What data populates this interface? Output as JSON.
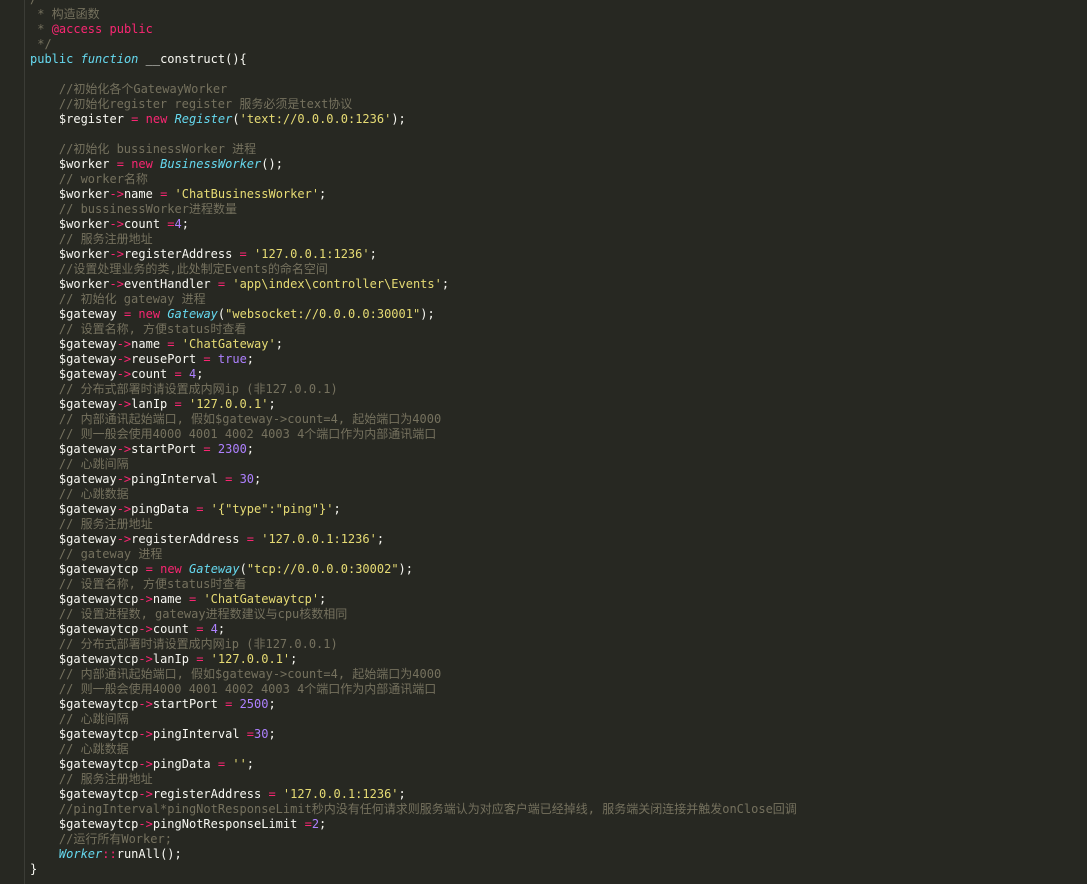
{
  "editor": {
    "lines": [
      [
        [
          "cm",
          "/**"
        ]
      ],
      [
        [
          "cm",
          " * 构造函数"
        ]
      ],
      [
        [
          "cm",
          " * "
        ],
        [
          "ann",
          "@access"
        ],
        [
          "cm",
          " "
        ],
        [
          "ann",
          "public"
        ]
      ],
      [
        [
          "cm",
          " */"
        ]
      ],
      [
        [
          "kw",
          "public"
        ],
        [
          "txt",
          " "
        ],
        [
          "kwi",
          "function"
        ],
        [
          "txt",
          " "
        ],
        [
          "fn",
          "__construct"
        ],
        [
          "pun",
          "(){"
        ]
      ],
      [],
      [
        [
          "txt",
          "    "
        ],
        [
          "cm",
          "//初始化各个GatewayWorker"
        ]
      ],
      [
        [
          "txt",
          "    "
        ],
        [
          "cm",
          "//初始化register register 服务必须是text协议"
        ]
      ],
      [
        [
          "txt",
          "    "
        ],
        [
          "var",
          "$register"
        ],
        [
          "txt",
          " "
        ],
        [
          "op",
          "="
        ],
        [
          "txt",
          " "
        ],
        [
          "op",
          "new"
        ],
        [
          "txt",
          " "
        ],
        [
          "cls",
          "Register"
        ],
        [
          "pun",
          "("
        ],
        [
          "str",
          "'text://0.0.0.0:1236'"
        ],
        [
          "pun",
          ");"
        ]
      ],
      [],
      [
        [
          "txt",
          "    "
        ],
        [
          "cm",
          "//初始化 bussinessWorker 进程"
        ]
      ],
      [
        [
          "txt",
          "    "
        ],
        [
          "var",
          "$worker"
        ],
        [
          "txt",
          " "
        ],
        [
          "op",
          "="
        ],
        [
          "txt",
          " "
        ],
        [
          "op",
          "new"
        ],
        [
          "txt",
          " "
        ],
        [
          "cls",
          "BusinessWorker"
        ],
        [
          "pun",
          "();"
        ]
      ],
      [
        [
          "txt",
          "    "
        ],
        [
          "cm",
          "// worker名称"
        ]
      ],
      [
        [
          "txt",
          "    "
        ],
        [
          "var",
          "$worker"
        ],
        [
          "op",
          "->"
        ],
        [
          "prop",
          "name"
        ],
        [
          "txt",
          " "
        ],
        [
          "op",
          "="
        ],
        [
          "txt",
          " "
        ],
        [
          "str",
          "'ChatBusinessWorker'"
        ],
        [
          "pun",
          ";"
        ]
      ],
      [
        [
          "txt",
          "    "
        ],
        [
          "cm",
          "// bussinessWorker进程数量"
        ]
      ],
      [
        [
          "txt",
          "    "
        ],
        [
          "var",
          "$worker"
        ],
        [
          "op",
          "->"
        ],
        [
          "prop",
          "count"
        ],
        [
          "txt",
          " "
        ],
        [
          "op",
          "="
        ],
        [
          "num",
          "4"
        ],
        [
          "pun",
          ";"
        ]
      ],
      [
        [
          "txt",
          "    "
        ],
        [
          "cm",
          "// 服务注册地址"
        ]
      ],
      [
        [
          "txt",
          "    "
        ],
        [
          "var",
          "$worker"
        ],
        [
          "op",
          "->"
        ],
        [
          "prop",
          "registerAddress"
        ],
        [
          "txt",
          " "
        ],
        [
          "op",
          "="
        ],
        [
          "txt",
          " "
        ],
        [
          "str",
          "'127.0.0.1:1236'"
        ],
        [
          "pun",
          ";"
        ]
      ],
      [
        [
          "txt",
          "    "
        ],
        [
          "cm",
          "//设置处理业务的类,此处制定Events的命名空间"
        ]
      ],
      [
        [
          "txt",
          "    "
        ],
        [
          "var",
          "$worker"
        ],
        [
          "op",
          "->"
        ],
        [
          "prop",
          "eventHandler"
        ],
        [
          "txt",
          " "
        ],
        [
          "op",
          "="
        ],
        [
          "txt",
          " "
        ],
        [
          "str",
          "'app\\index\\controller\\Events'"
        ],
        [
          "pun",
          ";"
        ]
      ],
      [
        [
          "txt",
          "    "
        ],
        [
          "cm",
          "// 初始化 gateway 进程"
        ]
      ],
      [
        [
          "txt",
          "    "
        ],
        [
          "var",
          "$gateway"
        ],
        [
          "txt",
          " "
        ],
        [
          "op",
          "="
        ],
        [
          "txt",
          " "
        ],
        [
          "op",
          "new"
        ],
        [
          "txt",
          " "
        ],
        [
          "cls",
          "Gateway"
        ],
        [
          "pun",
          "("
        ],
        [
          "str",
          "\"websocket://0.0.0.0:30001\""
        ],
        [
          "pun",
          ");"
        ]
      ],
      [
        [
          "txt",
          "    "
        ],
        [
          "cm",
          "// 设置名称, 方便status时查看"
        ]
      ],
      [
        [
          "txt",
          "    "
        ],
        [
          "var",
          "$gateway"
        ],
        [
          "op",
          "->"
        ],
        [
          "prop",
          "name"
        ],
        [
          "txt",
          " "
        ],
        [
          "op",
          "="
        ],
        [
          "txt",
          " "
        ],
        [
          "str",
          "'ChatGateway'"
        ],
        [
          "pun",
          ";"
        ]
      ],
      [
        [
          "txt",
          "    "
        ],
        [
          "var",
          "$gateway"
        ],
        [
          "op",
          "->"
        ],
        [
          "prop",
          "reusePort"
        ],
        [
          "txt",
          " "
        ],
        [
          "op",
          "="
        ],
        [
          "txt",
          " "
        ],
        [
          "bool",
          "true"
        ],
        [
          "pun",
          ";"
        ]
      ],
      [
        [
          "txt",
          "    "
        ],
        [
          "var",
          "$gateway"
        ],
        [
          "op",
          "->"
        ],
        [
          "prop",
          "count"
        ],
        [
          "txt",
          " "
        ],
        [
          "op",
          "="
        ],
        [
          "txt",
          " "
        ],
        [
          "num",
          "4"
        ],
        [
          "pun",
          ";"
        ]
      ],
      [
        [
          "txt",
          "    "
        ],
        [
          "cm",
          "// 分布式部署时请设置成内网ip (非127.0.0.1)"
        ]
      ],
      [
        [
          "txt",
          "    "
        ],
        [
          "var",
          "$gateway"
        ],
        [
          "op",
          "->"
        ],
        [
          "prop",
          "lanIp"
        ],
        [
          "txt",
          " "
        ],
        [
          "op",
          "="
        ],
        [
          "txt",
          " "
        ],
        [
          "str",
          "'127.0.0.1'"
        ],
        [
          "pun",
          ";"
        ]
      ],
      [
        [
          "txt",
          "    "
        ],
        [
          "cm",
          "// 内部通讯起始端口, 假如$gateway->count=4, 起始端口为4000"
        ]
      ],
      [
        [
          "txt",
          "    "
        ],
        [
          "cm",
          "// 则一般会使用4000 4001 4002 4003 4个端口作为内部通讯端口"
        ]
      ],
      [
        [
          "txt",
          "    "
        ],
        [
          "var",
          "$gateway"
        ],
        [
          "op",
          "->"
        ],
        [
          "prop",
          "startPort"
        ],
        [
          "txt",
          " "
        ],
        [
          "op",
          "="
        ],
        [
          "txt",
          " "
        ],
        [
          "num",
          "2300"
        ],
        [
          "pun",
          ";"
        ]
      ],
      [
        [
          "txt",
          "    "
        ],
        [
          "cm",
          "// 心跳间隔"
        ]
      ],
      [
        [
          "txt",
          "    "
        ],
        [
          "var",
          "$gateway"
        ],
        [
          "op",
          "->"
        ],
        [
          "prop",
          "pingInterval"
        ],
        [
          "txt",
          " "
        ],
        [
          "op",
          "="
        ],
        [
          "txt",
          " "
        ],
        [
          "num",
          "30"
        ],
        [
          "pun",
          ";"
        ]
      ],
      [
        [
          "txt",
          "    "
        ],
        [
          "cm",
          "// 心跳数据"
        ]
      ],
      [
        [
          "txt",
          "    "
        ],
        [
          "var",
          "$gateway"
        ],
        [
          "op",
          "->"
        ],
        [
          "prop",
          "pingData"
        ],
        [
          "txt",
          " "
        ],
        [
          "op",
          "="
        ],
        [
          "txt",
          " "
        ],
        [
          "str",
          "'{\"type\":\"ping\"}'"
        ],
        [
          "pun",
          ";"
        ]
      ],
      [
        [
          "txt",
          "    "
        ],
        [
          "cm",
          "// 服务注册地址"
        ]
      ],
      [
        [
          "txt",
          "    "
        ],
        [
          "var",
          "$gateway"
        ],
        [
          "op",
          "->"
        ],
        [
          "prop",
          "registerAddress"
        ],
        [
          "txt",
          " "
        ],
        [
          "op",
          "="
        ],
        [
          "txt",
          " "
        ],
        [
          "str",
          "'127.0.0.1:1236'"
        ],
        [
          "pun",
          ";"
        ]
      ],
      [
        [
          "txt",
          "    "
        ],
        [
          "cm",
          "// gateway 进程"
        ]
      ],
      [
        [
          "txt",
          "    "
        ],
        [
          "var",
          "$gatewaytcp"
        ],
        [
          "txt",
          " "
        ],
        [
          "op",
          "="
        ],
        [
          "txt",
          " "
        ],
        [
          "op",
          "new"
        ],
        [
          "txt",
          " "
        ],
        [
          "cls",
          "Gateway"
        ],
        [
          "pun",
          "("
        ],
        [
          "str",
          "\"tcp://0.0.0.0:30002\""
        ],
        [
          "pun",
          ");"
        ]
      ],
      [
        [
          "txt",
          "    "
        ],
        [
          "cm",
          "// 设置名称, 方便status时查看"
        ]
      ],
      [
        [
          "txt",
          "    "
        ],
        [
          "var",
          "$gatewaytcp"
        ],
        [
          "op",
          "->"
        ],
        [
          "prop",
          "name"
        ],
        [
          "txt",
          " "
        ],
        [
          "op",
          "="
        ],
        [
          "txt",
          " "
        ],
        [
          "str",
          "'ChatGatewaytcp'"
        ],
        [
          "pun",
          ";"
        ]
      ],
      [
        [
          "txt",
          "    "
        ],
        [
          "cm",
          "// 设置进程数, gateway进程数建议与cpu核数相同"
        ]
      ],
      [
        [
          "txt",
          "    "
        ],
        [
          "var",
          "$gatewaytcp"
        ],
        [
          "op",
          "->"
        ],
        [
          "prop",
          "count"
        ],
        [
          "txt",
          " "
        ],
        [
          "op",
          "="
        ],
        [
          "txt",
          " "
        ],
        [
          "num",
          "4"
        ],
        [
          "pun",
          ";"
        ]
      ],
      [
        [
          "txt",
          "    "
        ],
        [
          "cm",
          "// 分布式部署时请设置成内网ip (非127.0.0.1)"
        ]
      ],
      [
        [
          "txt",
          "    "
        ],
        [
          "var",
          "$gatewaytcp"
        ],
        [
          "op",
          "->"
        ],
        [
          "prop",
          "lanIp"
        ],
        [
          "txt",
          " "
        ],
        [
          "op",
          "="
        ],
        [
          "txt",
          " "
        ],
        [
          "str",
          "'127.0.0.1'"
        ],
        [
          "pun",
          ";"
        ]
      ],
      [
        [
          "txt",
          "    "
        ],
        [
          "cm",
          "// 内部通讯起始端口, 假如$gateway->count=4, 起始端口为4000"
        ]
      ],
      [
        [
          "txt",
          "    "
        ],
        [
          "cm",
          "// 则一般会使用4000 4001 4002 4003 4个端口作为内部通讯端口"
        ]
      ],
      [
        [
          "txt",
          "    "
        ],
        [
          "var",
          "$gatewaytcp"
        ],
        [
          "op",
          "->"
        ],
        [
          "prop",
          "startPort"
        ],
        [
          "txt",
          " "
        ],
        [
          "op",
          "="
        ],
        [
          "txt",
          " "
        ],
        [
          "num",
          "2500"
        ],
        [
          "pun",
          ";"
        ]
      ],
      [
        [
          "txt",
          "    "
        ],
        [
          "cm",
          "// 心跳间隔"
        ]
      ],
      [
        [
          "txt",
          "    "
        ],
        [
          "var",
          "$gatewaytcp"
        ],
        [
          "op",
          "->"
        ],
        [
          "prop",
          "pingInterval"
        ],
        [
          "txt",
          " "
        ],
        [
          "op",
          "="
        ],
        [
          "num",
          "30"
        ],
        [
          "pun",
          ";"
        ]
      ],
      [
        [
          "txt",
          "    "
        ],
        [
          "cm",
          "// 心跳数据"
        ]
      ],
      [
        [
          "txt",
          "    "
        ],
        [
          "var",
          "$gatewaytcp"
        ],
        [
          "op",
          "->"
        ],
        [
          "prop",
          "pingData"
        ],
        [
          "txt",
          " "
        ],
        [
          "op",
          "="
        ],
        [
          "txt",
          " "
        ],
        [
          "str",
          "''"
        ],
        [
          "pun",
          ";"
        ]
      ],
      [
        [
          "txt",
          "    "
        ],
        [
          "cm",
          "// 服务注册地址"
        ]
      ],
      [
        [
          "txt",
          "    "
        ],
        [
          "var",
          "$gatewaytcp"
        ],
        [
          "op",
          "->"
        ],
        [
          "prop",
          "registerAddress"
        ],
        [
          "txt",
          " "
        ],
        [
          "op",
          "="
        ],
        [
          "txt",
          " "
        ],
        [
          "str",
          "'127.0.0.1:1236'"
        ],
        [
          "pun",
          ";"
        ]
      ],
      [
        [
          "txt",
          "    "
        ],
        [
          "cm",
          "//pingInterval*pingNotResponseLimit秒内没有任何请求则服务端认为对应客户端已经掉线, 服务端关闭连接并触发onClose回调"
        ]
      ],
      [
        [
          "txt",
          "    "
        ],
        [
          "var",
          "$gatewaytcp"
        ],
        [
          "op",
          "->"
        ],
        [
          "prop",
          "pingNotResponseLimit"
        ],
        [
          "txt",
          " "
        ],
        [
          "op",
          "="
        ],
        [
          "num",
          "2"
        ],
        [
          "pun",
          ";"
        ]
      ],
      [
        [
          "txt",
          "    "
        ],
        [
          "cm",
          "//运行所有Worker;"
        ]
      ],
      [
        [
          "txt",
          "    "
        ],
        [
          "cls",
          "Worker"
        ],
        [
          "op",
          "::"
        ],
        [
          "fn",
          "runAll"
        ],
        [
          "pun",
          "();"
        ]
      ],
      [
        [
          "pun",
          "}"
        ]
      ]
    ]
  }
}
